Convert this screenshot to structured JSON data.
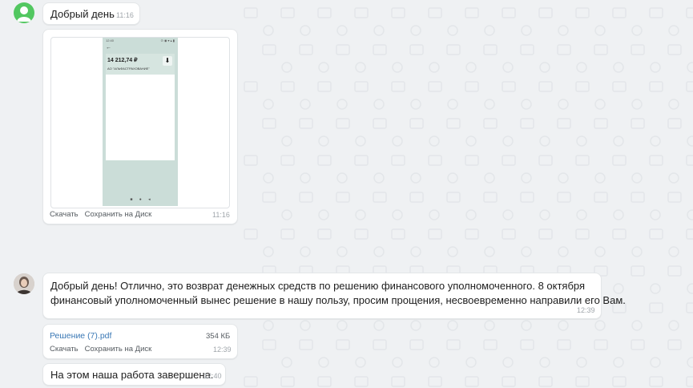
{
  "messages": {
    "m1": {
      "text": "Добрый день",
      "time": "11:16"
    },
    "m2": {
      "time": "11:16",
      "actions": {
        "download": "Скачать",
        "save_disk": "Сохранить на Диск"
      },
      "screenshot": {
        "status_left": "12:40",
        "status_right": "⊙ ◉ ▾ ▴ ▮",
        "amount": "14 212,74 ₽",
        "org": "АО \"АЛЬФАСТРАХОВАНИЕ\""
      }
    },
    "m3": {
      "line1": "Добрый день! Отлично, это возврат денежных средств по решению финансового уполномоченного. 8 октября",
      "line2": "финансовый уполномоченный вынес решение в нашу пользу, просим прощения, несвоевременно направили его Вам.",
      "time": "12:39"
    },
    "m4": {
      "file_name": "Решение (7).pdf",
      "file_size": "354 КБ",
      "time": "12:39",
      "actions": {
        "download": "Скачать",
        "save_disk": "Сохранить на Диск"
      }
    },
    "m5": {
      "text": "На этом наша работа завершена.",
      "time": "12:40"
    }
  },
  "colors": {
    "background": "#eff1f3",
    "avatar_green": "#52c760",
    "link": "#3a78b5"
  },
  "icons": {
    "avatar1": "user-silhouette-icon",
    "avatar2": "user-photo-avatar",
    "download_arrow": "download-arrow-icon"
  }
}
